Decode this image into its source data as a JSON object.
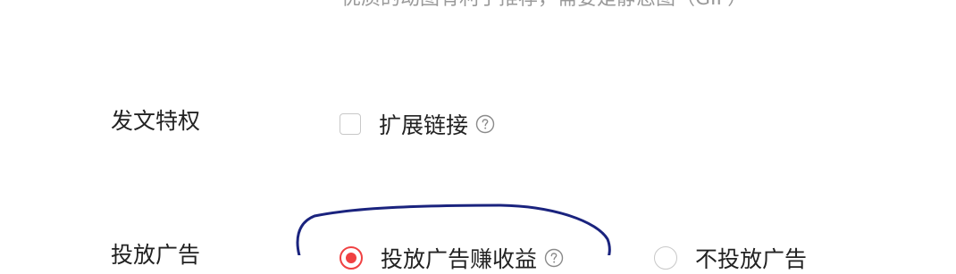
{
  "top_hint": "优质的动图有利于推荐，需要是静态图（GIF）",
  "privilege": {
    "label": "发文特权",
    "extend_link": {
      "label": "扩展链接",
      "checked": false,
      "help_icon": "question-circle-icon"
    }
  },
  "ads": {
    "label": "投放广告",
    "options": [
      {
        "label": "投放广告赚收益",
        "selected": true,
        "help_icon": "question-circle-icon"
      },
      {
        "label": "不投放广告",
        "selected": false
      }
    ]
  },
  "colors": {
    "accent": "#f04142",
    "annotation_circle": "#1a237e",
    "hint_text": "#9a9a9a",
    "control_border": "#c8c8c8"
  }
}
